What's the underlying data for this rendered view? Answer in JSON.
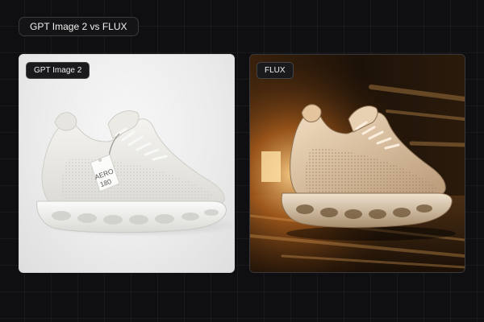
{
  "header": {
    "title": "GPT Image 2 vs FLUX"
  },
  "panels": [
    {
      "label": "GPT Image 2",
      "hang_tag_lines": [
        "AERO",
        "180"
      ]
    },
    {
      "label": "FLUX"
    }
  ]
}
